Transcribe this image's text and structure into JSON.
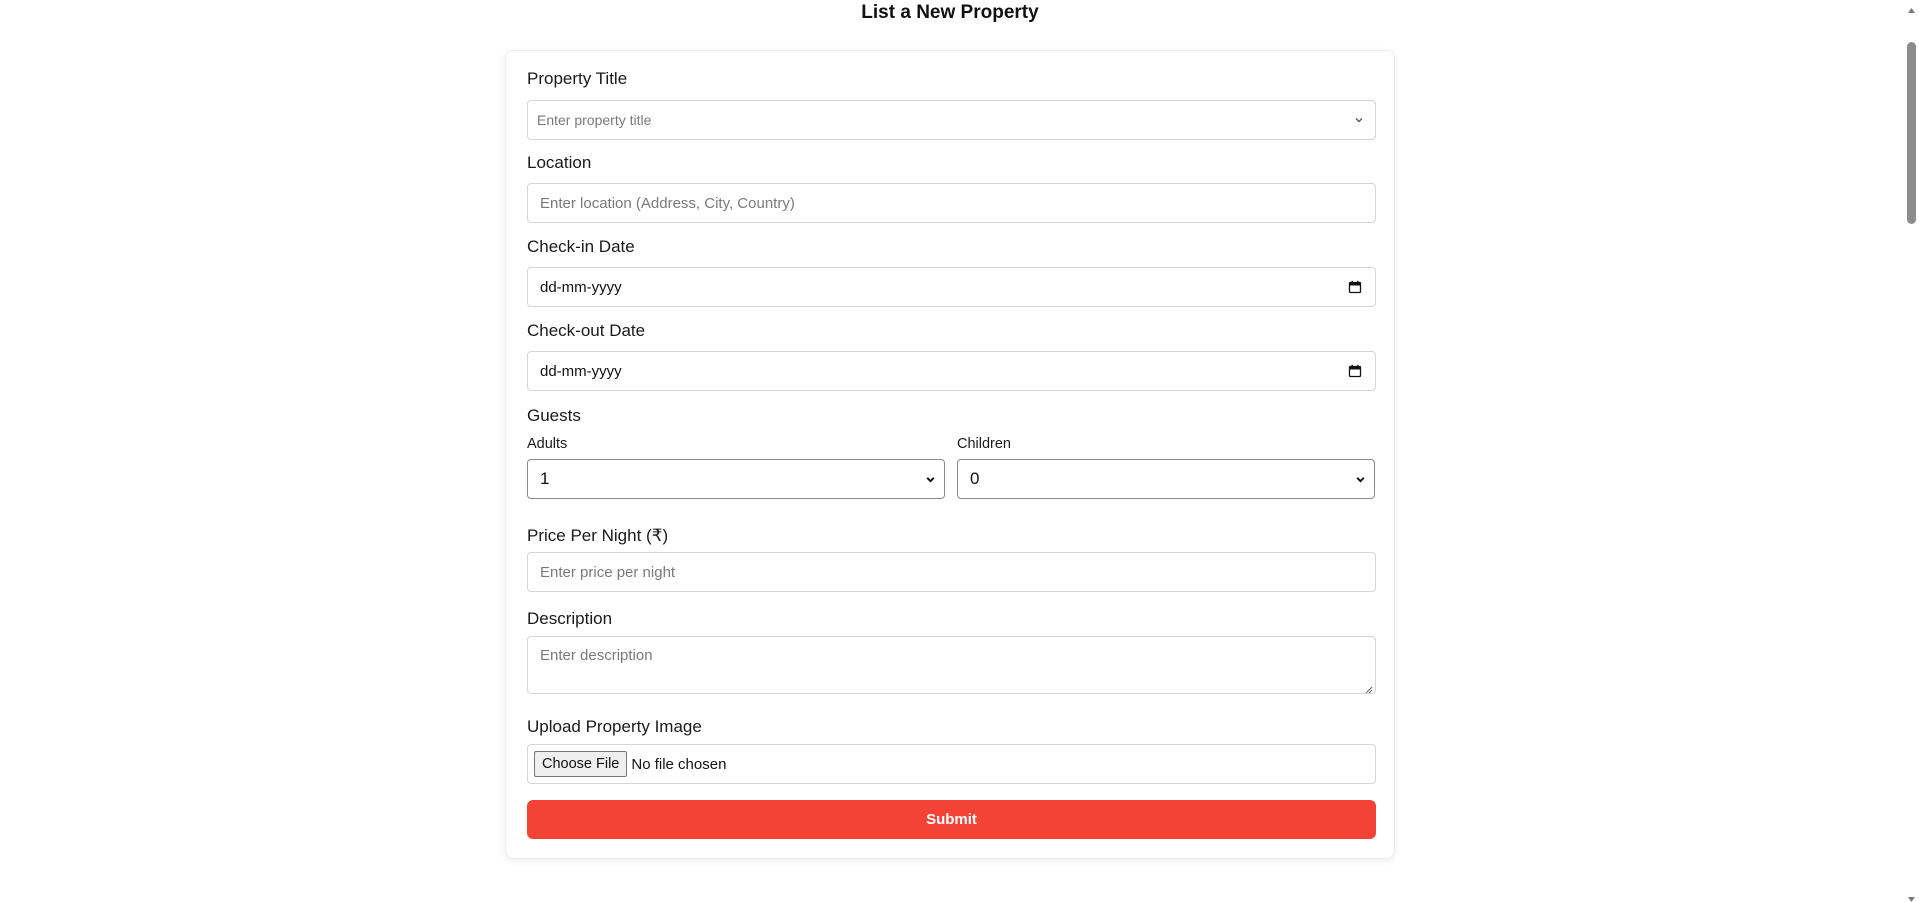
{
  "page": {
    "title": "List a New Property"
  },
  "form": {
    "property_title": {
      "label": "Property Title",
      "placeholder": "Enter property title"
    },
    "location": {
      "label": "Location",
      "placeholder": "Enter location (Address, City, Country)"
    },
    "check_in": {
      "label": "Check-in Date",
      "value": "dd-mm-yyyy"
    },
    "check_out": {
      "label": "Check-out Date",
      "value": "dd-mm-yyyy"
    },
    "guests": {
      "label": "Guests",
      "adults_label": "Adults",
      "adults_value": "1",
      "children_label": "Children",
      "children_value": "0"
    },
    "price": {
      "label": "Price Per Night (₹)",
      "placeholder": "Enter price per night"
    },
    "description": {
      "label": "Description",
      "placeholder": "Enter description"
    },
    "image": {
      "label": "Upload Property Image",
      "button_label": "Choose File",
      "status": "No file chosen"
    },
    "submit_label": "Submit"
  },
  "icons": {
    "dropdown": "chevron-down-icon",
    "calendar": "calendar-icon",
    "resize": "resize-handle-icon"
  },
  "colors": {
    "accent": "#f44336",
    "border": "#d6d6d6",
    "scrollbar_thumb": "#8c8c8c"
  }
}
